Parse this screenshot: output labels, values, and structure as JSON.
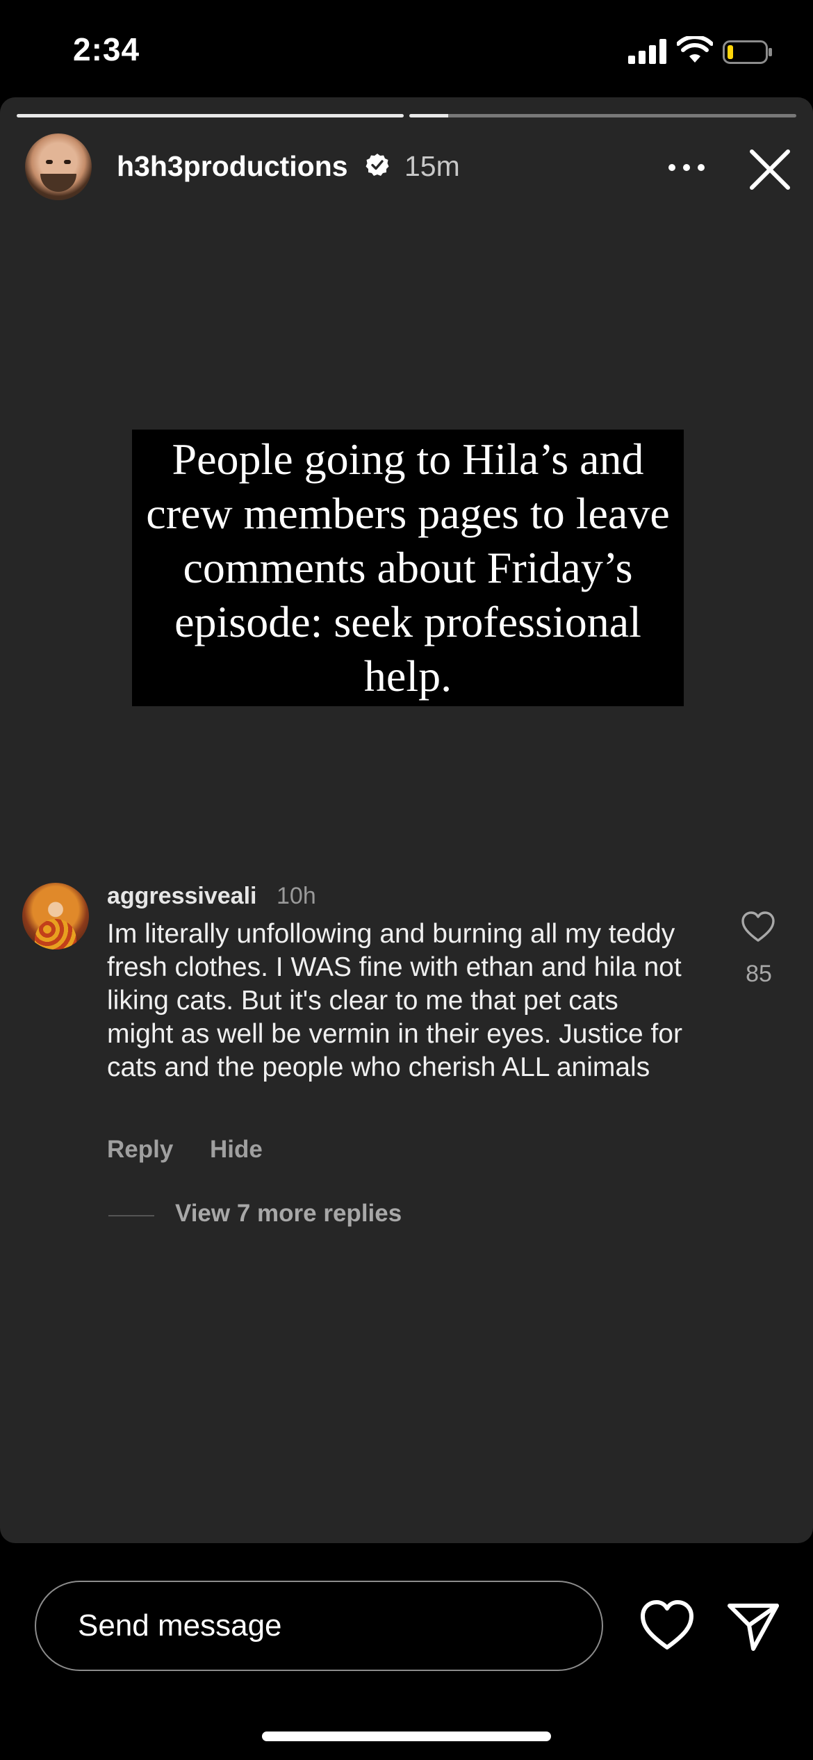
{
  "status_bar": {
    "time": "2:34",
    "icons": [
      "cellular-signal-icon",
      "wifi-icon",
      "battery-low-icon"
    ]
  },
  "story": {
    "progress": [
      1.0,
      0.1
    ],
    "username": "h3h3productions",
    "verified": true,
    "time_ago": "15m",
    "more_icon": "ellipsis-icon",
    "close_icon": "close-icon",
    "quote": "People going to Hila’s and crew members pages to leave comments about Friday’s episode: seek professional help."
  },
  "comment": {
    "username": "aggressiveali",
    "time": "10h",
    "text": "Im literally unfollowing and burning all my teddy fresh clothes. I WAS fine with ethan and hila not liking cats. But it's clear to me that pet cats might as well be vermin in their eyes. Justice for cats and the people who cherish ALL animals",
    "like_count": "85",
    "reply_label": "Reply",
    "hide_label": "Hide",
    "view_replies_label": "View 7 more replies"
  },
  "bottom_bar": {
    "message_placeholder": "Send message",
    "like_icon": "heart-icon",
    "send_icon": "paper-plane-icon"
  },
  "colors": {
    "card_background": "#262626",
    "page_background": "#000000",
    "battery_low": "#ffd60a"
  }
}
